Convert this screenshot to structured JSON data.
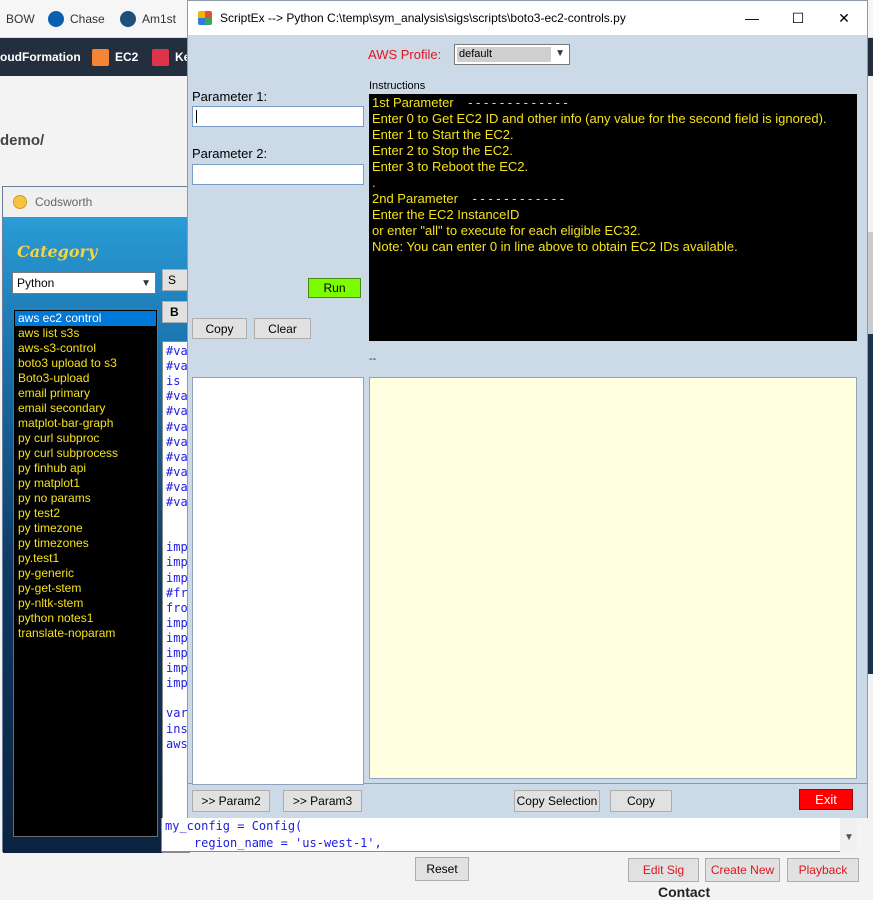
{
  "browser": {
    "bookmarks": [
      "BOW",
      "Chase",
      "Am1st"
    ],
    "nav_items": [
      "oudFormation",
      "EC2",
      "Ke"
    ],
    "breadcrumb": "demo/",
    "footer_text": "Contact"
  },
  "codsworth": {
    "title": "Codsworth",
    "category_label": "Category",
    "category_value": "Python",
    "side_btn_1": "S",
    "side_btn_2": "B",
    "scripts": [
      "aws ec2 control",
      "aws list s3s",
      "aws-s3-control",
      "boto3 upload to s3",
      "Boto3-upload",
      "email primary",
      "email secondary",
      "matplot-bar-graph",
      "py curl subproc",
      "py curl subprocess",
      "py finhub api",
      "py matplot1",
      "py no params",
      "py test2",
      "py timezone",
      "py timezones",
      "py.test1",
      "py-generic",
      "py-get-stem",
      "py-nltk-stem",
      "python notes1",
      "translate-noparam"
    ],
    "selected_index": 0,
    "code_lines": [
      "#va",
      "#va",
      "is",
      "#va",
      "#va",
      "#va",
      "#va",
      "#va",
      "#va",
      "#va",
      "#va",
      "",
      "",
      "imp",
      "imp",
      "imp",
      "#fr",
      "fro",
      "imp",
      "imp",
      "imp",
      "imp",
      "imp",
      "",
      "var",
      "ins",
      "aws"
    ],
    "code_bottom": [
      "my_config = Config(",
      "    region_name = 'us-west-1',"
    ],
    "reset_label": "Reset",
    "edit_sig_label": "Edit Sig",
    "create_new_label": "Create New",
    "playback_label": "Playback"
  },
  "scriptex": {
    "title": "ScriptEx -->  Python  C:\\temp\\sym_analysis\\sigs\\scripts\\boto3-ec2-controls.py",
    "aws_profile_label": "AWS Profile:",
    "aws_profile_value": "default",
    "param1_label": "Parameter 1:",
    "param2_label": "Parameter 2:",
    "param1_value": "",
    "param2_value": "",
    "instructions_label": "Instructions",
    "instructions": [
      "1st Parameter    - - - - - - - - - - - - -",
      "Enter 0 to Get EC2 ID and other info (any value for the second field is ignored).",
      "Enter 1 to Start the EC2.",
      "Enter 2 to Stop the EC2.",
      "Enter 3 to Reboot the EC2.",
      ".",
      "2nd Parameter    - - - - - - - - - - - -",
      "Enter the EC2 InstanceID",
      "or enter \"all\" to execute for each eligible EC32.",
      "Note: You can enter 0 in line above to obtain EC2 IDs available."
    ],
    "run_label": "Run",
    "copy_label": "Copy",
    "clear_label": "Clear",
    "dashes": "--",
    "param2_btn": ">> Param2",
    "param3_btn": ">> Param3",
    "copy_selection_label": "Copy Selection",
    "copy2_label": "Copy",
    "exit_label": "Exit",
    "win_buttons": [
      "—",
      "☐",
      "✕"
    ]
  }
}
